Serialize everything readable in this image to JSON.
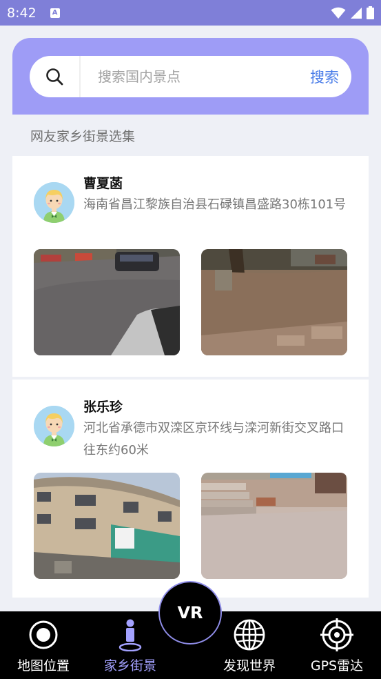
{
  "status_bar": {
    "time": "8:42",
    "notification_icon": "a-letter-icon",
    "wifi_icon": "wifi-icon",
    "signal_icon": "signal-icon",
    "battery_icon": "battery-icon"
  },
  "search": {
    "placeholder": "搜索国内景点",
    "value": "",
    "button_label": "搜索",
    "icon": "search-icon"
  },
  "section_title": "网友家乡街景选集",
  "posts": [
    {
      "name": "曹夏菡",
      "address": "海南省昌江黎族自治县石碌镇昌盛路30栋101号",
      "avatar": "avatar-icon",
      "images": [
        "street-view-photo-road",
        "street-view-photo-courtyard"
      ]
    },
    {
      "name": "张乐珍",
      "address": "河北省承德市双滦区京环线与滦河新街交叉路口往东约60米",
      "avatar": "avatar-icon",
      "images": [
        "street-view-photo-building",
        "street-view-photo-steps"
      ]
    }
  ],
  "nav": {
    "items": [
      {
        "label": "地图位置",
        "icon": "target-icon",
        "active": false
      },
      {
        "label": "家乡街景",
        "icon": "person-pin-icon",
        "active": true
      },
      {
        "label": "发现世界",
        "icon": "globe-icon",
        "active": false
      },
      {
        "label": "GPS雷达",
        "icon": "radar-icon",
        "active": false
      }
    ],
    "vr_label": "VR"
  },
  "colors": {
    "status_bar": "#7f7fd8",
    "search_card": "#9e9cf6",
    "search_button": "#4a7de8",
    "nav_active": "#a3a1ff"
  }
}
